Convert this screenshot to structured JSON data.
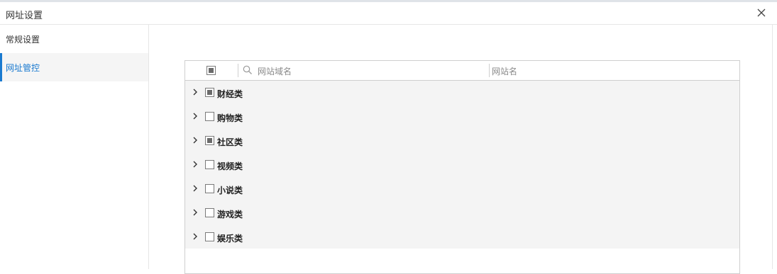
{
  "window": {
    "title": "网址设置",
    "close_icon": "close-icon"
  },
  "sidebar": {
    "items": [
      {
        "label": "常规设置",
        "active": false
      },
      {
        "label": "网址管控",
        "active": true
      }
    ]
  },
  "table": {
    "header": {
      "select_all_state": "partial",
      "search_placeholder": "网站域名",
      "column_name": "网站名"
    },
    "rows": [
      {
        "label": "财经类",
        "state": "partial"
      },
      {
        "label": "购物类",
        "state": "unchecked"
      },
      {
        "label": "社区类",
        "state": "partial"
      },
      {
        "label": "视频类",
        "state": "unchecked"
      },
      {
        "label": "小说类",
        "state": "unchecked"
      },
      {
        "label": "游戏类",
        "state": "unchecked"
      },
      {
        "label": "娱乐类",
        "state": "unchecked"
      }
    ]
  },
  "colors": {
    "accent": "#1a7ad0",
    "row_bg": "#f4f4f4",
    "border": "#cfcfcf"
  }
}
